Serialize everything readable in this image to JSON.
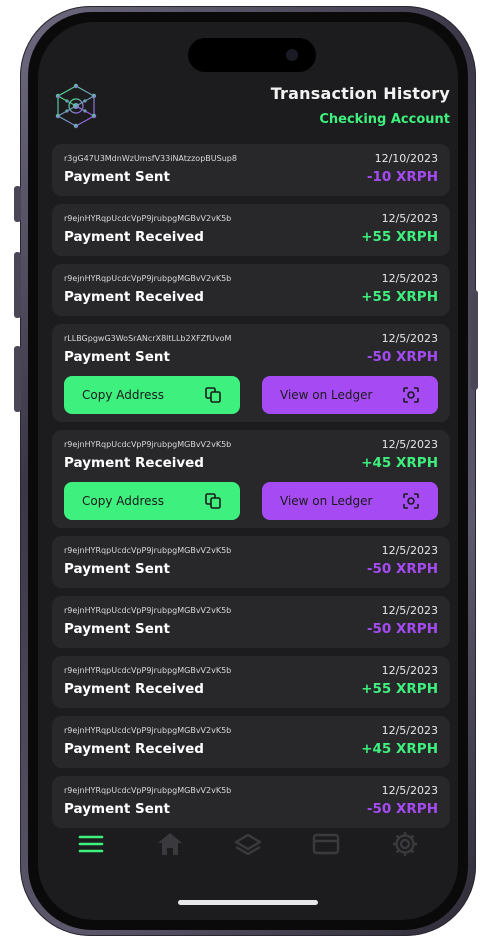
{
  "header": {
    "title": "Transaction History",
    "account": "Checking Account",
    "logo_icon": "network-cube-icon"
  },
  "colors": {
    "accent_green": "#3ef07e",
    "accent_purple": "#a64bf4",
    "card_bg": "#28282b",
    "screen_bg": "#1c1c1e"
  },
  "transactions": [
    {
      "address": "r3gG47U3MdnWzUmsfV33iNAtzzopBUSup8",
      "date": "12/10/2023",
      "type": "Payment Sent",
      "amount": "-10 XRPH"
    },
    {
      "address": "r9ejnHYRqpUcdcVpP9jrubpgMGBvV2vK5b",
      "date": "12/5/2023",
      "type": "Payment Received",
      "amount": "+55 XRPH"
    },
    {
      "address": "r9ejnHYRqpUcdcVpP9jrubpgMGBvV2vK5b",
      "date": "12/5/2023",
      "type": "Payment Received",
      "amount": "+55 XRPH"
    },
    {
      "address": "rLLBGpgwG3WoSrANcrX8ltLLb2XFZfUvoM",
      "date": "12/5/2023",
      "type": "Payment Sent",
      "amount": "-50 XRPH"
    },
    {
      "address": "r9ejnHYRqpUcdcVpP9jrubpgMGBvV2vK5b",
      "date": "12/5/2023",
      "type": "Payment Received",
      "amount": "+45 XRPH"
    },
    {
      "address": "r9ejnHYRqpUcdcVpP9jrubpgMGBvV2vK5b",
      "date": "12/5/2023",
      "type": "Payment Sent",
      "amount": "-50 XRPH"
    },
    {
      "address": "r9ejnHYRqpUcdcVpP9jrubpgMGBvV2vK5b",
      "date": "12/5/2023",
      "type": "Payment Sent",
      "amount": "-50 XRPH"
    },
    {
      "address": "r9ejnHYRqpUcdcVpP9jrubpgMGBvV2vK5b",
      "date": "12/5/2023",
      "type": "Payment Received",
      "amount": "+55 XRPH"
    },
    {
      "address": "r9ejnHYRqpUcdcVpP9jrubpgMGBvV2vK5b",
      "date": "12/5/2023",
      "type": "Payment Received",
      "amount": "+45 XRPH"
    },
    {
      "address": "r9ejnHYRqpUcdcVpP9jrubpgMGBvV2vK5b",
      "date": "12/5/2023",
      "type": "Payment Sent",
      "amount": "-50 XRPH"
    }
  ],
  "actions": {
    "copy_label": "Copy Address",
    "ledger_label": "View on Ledger",
    "copy_icon": "copy-icon",
    "ledger_icon": "scan-icon"
  },
  "tabbar": [
    {
      "name": "menu-icon",
      "active": true
    },
    {
      "name": "home-icon",
      "active": false
    },
    {
      "name": "layers-icon",
      "active": false
    },
    {
      "name": "card-icon",
      "active": false
    },
    {
      "name": "gear-icon",
      "active": false
    }
  ]
}
